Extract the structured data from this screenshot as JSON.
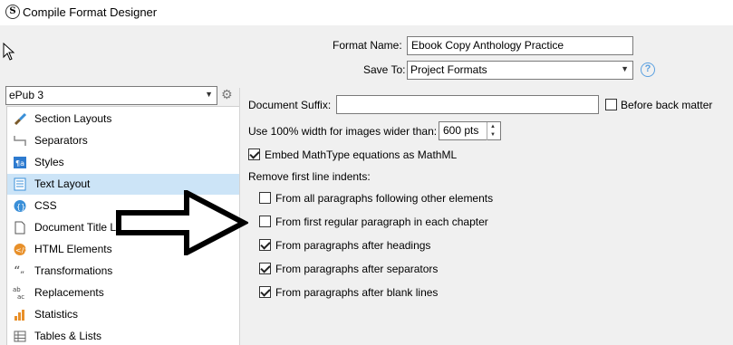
{
  "window": {
    "title": "Compile Format Designer"
  },
  "format_name": {
    "label": "Format Name:",
    "value": "Ebook Copy Anthology Practice"
  },
  "save_to": {
    "label": "Save To:",
    "value": "Project Formats"
  },
  "format_select": {
    "value": "ePub 3"
  },
  "sidebar": {
    "items": [
      {
        "label": "Section Layouts",
        "icon": "brush-icon"
      },
      {
        "label": "Separators",
        "icon": "separator-icon"
      },
      {
        "label": "Styles",
        "icon": "styles-icon"
      },
      {
        "label": "Text Layout",
        "icon": "text-layout-icon",
        "selected": true
      },
      {
        "label": "CSS",
        "icon": "css-icon"
      },
      {
        "label": "Document Title Links",
        "icon": "document-icon"
      },
      {
        "label": "HTML Elements",
        "icon": "html-icon"
      },
      {
        "label": "Transformations",
        "icon": "quotes-icon"
      },
      {
        "label": "Replacements",
        "icon": "replace-icon"
      },
      {
        "label": "Statistics",
        "icon": "chart-icon"
      },
      {
        "label": "Tables & Lists",
        "icon": "table-icon"
      }
    ]
  },
  "main": {
    "document_suffix": {
      "label": "Document Suffix:",
      "value": ""
    },
    "before_back_matter": {
      "label": "Before back matter",
      "checked": false
    },
    "image_width": {
      "label": "Use 100% width for images wider than:",
      "value": "600 pts"
    },
    "embed_mathtype": {
      "label": "Embed MathType equations as MathML",
      "checked": true
    },
    "remove_indents": {
      "label": "Remove first line indents:",
      "options": [
        {
          "label": "From all paragraphs following other elements",
          "checked": false
        },
        {
          "label": "From first regular paragraph in each chapter",
          "checked": false
        },
        {
          "label": "From paragraphs after headings",
          "checked": true
        },
        {
          "label": "From paragraphs after separators",
          "checked": true
        },
        {
          "label": "From paragraphs after blank lines",
          "checked": true
        }
      ]
    }
  },
  "colors": {
    "selection": "#cce4f7",
    "help": "#5aa0e0"
  }
}
